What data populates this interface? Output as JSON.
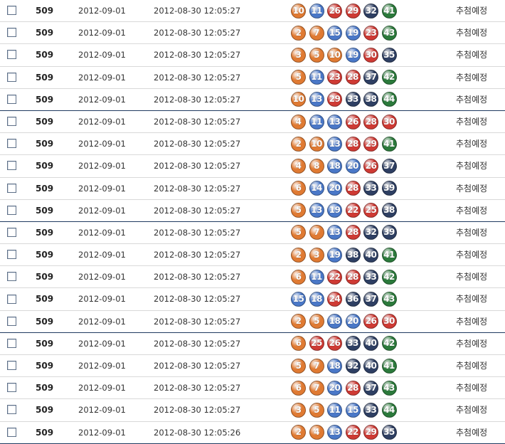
{
  "colors": {
    "orange": "#e07a32",
    "blue": "#4a78c8",
    "red": "#cf3a34",
    "navy": "#2e3f63",
    "green": "#2b7a3b",
    "group_border": "#1f3a60"
  },
  "rows": [
    {
      "round": "509",
      "draw_date": "2012-09-01",
      "purchase_time": "2012-08-30 12:05:27",
      "numbers": [
        10,
        11,
        26,
        29,
        32,
        41
      ],
      "status": "추첨예정"
    },
    {
      "round": "509",
      "draw_date": "2012-09-01",
      "purchase_time": "2012-08-30 12:05:27",
      "numbers": [
        2,
        7,
        15,
        19,
        23,
        43
      ],
      "status": "추첨예정"
    },
    {
      "round": "509",
      "draw_date": "2012-09-01",
      "purchase_time": "2012-08-30 12:05:27",
      "numbers": [
        3,
        5,
        10,
        19,
        30,
        35
      ],
      "status": "추첨예정"
    },
    {
      "round": "509",
      "draw_date": "2012-09-01",
      "purchase_time": "2012-08-30 12:05:27",
      "numbers": [
        5,
        11,
        23,
        28,
        37,
        42
      ],
      "status": "추첨예정"
    },
    {
      "round": "509",
      "draw_date": "2012-09-01",
      "purchase_time": "2012-08-30 12:05:27",
      "numbers": [
        10,
        13,
        29,
        33,
        38,
        44
      ],
      "status": "추첨예정"
    },
    {
      "round": "509",
      "draw_date": "2012-09-01",
      "purchase_time": "2012-08-30 12:05:27",
      "numbers": [
        4,
        11,
        13,
        26,
        28,
        30
      ],
      "status": "추첨예정"
    },
    {
      "round": "509",
      "draw_date": "2012-09-01",
      "purchase_time": "2012-08-30 12:05:27",
      "numbers": [
        2,
        10,
        13,
        28,
        29,
        41
      ],
      "status": "추첨예정"
    },
    {
      "round": "509",
      "draw_date": "2012-09-01",
      "purchase_time": "2012-08-30 12:05:27",
      "numbers": [
        4,
        8,
        18,
        20,
        26,
        37
      ],
      "status": "추첨예정"
    },
    {
      "round": "509",
      "draw_date": "2012-09-01",
      "purchase_time": "2012-08-30 12:05:27",
      "numbers": [
        6,
        14,
        20,
        28,
        33,
        39
      ],
      "status": "추첨예정"
    },
    {
      "round": "509",
      "draw_date": "2012-09-01",
      "purchase_time": "2012-08-30 12:05:27",
      "numbers": [
        5,
        13,
        19,
        22,
        25,
        38
      ],
      "status": "추첨예정"
    },
    {
      "round": "509",
      "draw_date": "2012-09-01",
      "purchase_time": "2012-08-30 12:05:27",
      "numbers": [
        5,
        7,
        13,
        28,
        32,
        39
      ],
      "status": "추첨예정"
    },
    {
      "round": "509",
      "draw_date": "2012-09-01",
      "purchase_time": "2012-08-30 12:05:27",
      "numbers": [
        2,
        3,
        19,
        38,
        40,
        41
      ],
      "status": "추첨예정"
    },
    {
      "round": "509",
      "draw_date": "2012-09-01",
      "purchase_time": "2012-08-30 12:05:27",
      "numbers": [
        6,
        11,
        22,
        28,
        33,
        42
      ],
      "status": "추첨예정"
    },
    {
      "round": "509",
      "draw_date": "2012-09-01",
      "purchase_time": "2012-08-30 12:05:27",
      "numbers": [
        15,
        18,
        24,
        36,
        37,
        43
      ],
      "status": "추첨예정"
    },
    {
      "round": "509",
      "draw_date": "2012-09-01",
      "purchase_time": "2012-08-30 12:05:27",
      "numbers": [
        2,
        5,
        18,
        20,
        26,
        30
      ],
      "status": "추첨예정"
    },
    {
      "round": "509",
      "draw_date": "2012-09-01",
      "purchase_time": "2012-08-30 12:05:27",
      "numbers": [
        6,
        25,
        26,
        33,
        40,
        42
      ],
      "status": "추첨예정"
    },
    {
      "round": "509",
      "draw_date": "2012-09-01",
      "purchase_time": "2012-08-30 12:05:27",
      "numbers": [
        5,
        7,
        18,
        32,
        40,
        41
      ],
      "status": "추첨예정"
    },
    {
      "round": "509",
      "draw_date": "2012-09-01",
      "purchase_time": "2012-08-30 12:05:27",
      "numbers": [
        6,
        7,
        20,
        28,
        37,
        43
      ],
      "status": "추첨예정"
    },
    {
      "round": "509",
      "draw_date": "2012-09-01",
      "purchase_time": "2012-08-30 12:05:27",
      "numbers": [
        3,
        5,
        11,
        15,
        33,
        44
      ],
      "status": "추첨예정"
    },
    {
      "round": "509",
      "draw_date": "2012-09-01",
      "purchase_time": "2012-08-30 12:05:26",
      "numbers": [
        2,
        4,
        13,
        22,
        29,
        35
      ],
      "status": "추첨예정"
    }
  ]
}
